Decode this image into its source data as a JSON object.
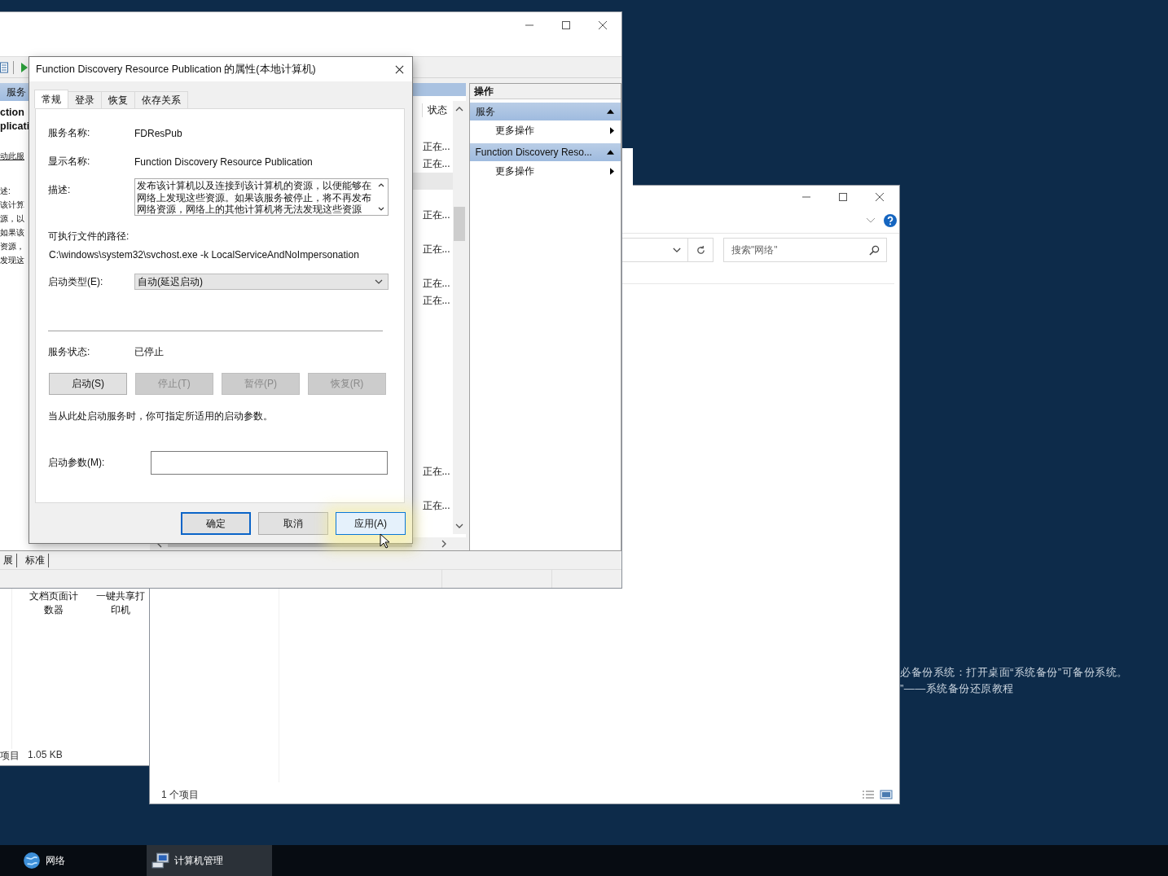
{
  "desktop": {
    "wallpaper_text": [
      "必备份系统：打开桌面“系统备份”可备份系统。",
      "”——系统备份还原教程"
    ]
  },
  "background_explorer": {
    "items": [
      {
        "label": "文档页面计数器"
      },
      {
        "label": "一键共享打印机"
      }
    ],
    "status": [
      "项目",
      "1.05 KB"
    ]
  },
  "network_window": {
    "search": {
      "placeholder": "搜索\"网络\""
    },
    "status_bar": "1 个项目"
  },
  "computer_management": {
    "left_pane": {
      "header": "服务",
      "title_lines": [
        "ction",
        "plicati"
      ],
      "link": "动此服",
      "text_lines": [
        "述:",
        "该计算",
        "源，以",
        "如果该",
        "资源，",
        "发现这"
      ]
    },
    "list": {
      "columns": [
        "状态"
      ],
      "rows": [
        {
          "status": "正在...",
          "selected": false
        },
        {
          "status": "正在...",
          "selected": false
        },
        {
          "selected": true
        },
        {
          "selected": false
        },
        {
          "status": "正在...",
          "selected": false
        },
        {
          "selected": false
        },
        {
          "status": "正在...",
          "selected": false
        },
        {
          "selected": false
        },
        {
          "status": "正在...",
          "selected": false
        },
        {
          "status": "正在...",
          "selected": false
        },
        {
          "selected": false
        },
        {
          "selected": false
        },
        {
          "selected": false
        },
        {
          "selected": false
        },
        {
          "selected": false
        },
        {
          "selected": false
        },
        {
          "selected": false
        },
        {
          "selected": false
        },
        {
          "selected": false
        },
        {
          "status": "正在...",
          "selected": false
        },
        {
          "selected": false
        },
        {
          "status": "正在...",
          "selected": false
        }
      ]
    },
    "actions": {
      "title": "操作",
      "groups": [
        {
          "title": "服务",
          "expanded": true,
          "items": [
            {
              "label": "更多操作"
            }
          ]
        },
        {
          "title": "Function Discovery Reso...",
          "expanded": true,
          "items": [
            {
              "label": "更多操作"
            }
          ]
        }
      ]
    },
    "view_tabs": [
      "展",
      "标准"
    ]
  },
  "dialog": {
    "title": "Function Discovery Resource Publication 的属性(本地计算机)",
    "tabs": [
      {
        "label": "常规",
        "selected": true
      },
      {
        "label": "登录",
        "selected": false
      },
      {
        "label": "恢复",
        "selected": false
      },
      {
        "label": "依存关系",
        "selected": false
      }
    ],
    "service_name": {
      "label": "服务名称:",
      "value": "FDResPub"
    },
    "display_name": {
      "label": "显示名称:",
      "value": "Function Discovery Resource Publication"
    },
    "description": {
      "label": "描述:",
      "value": "发布该计算机以及连接到该计算机的资源，以便能够在网络上发现这些资源。如果该服务被停止，将不再发布网络资源，网络上的其他计算机将无法发现这些资源"
    },
    "path": {
      "label": "可执行文件的路径:",
      "value": "C:\\windows\\system32\\svchost.exe -k LocalServiceAndNoImpersonation"
    },
    "startup_type": {
      "label": "启动类型(E):",
      "value": "自动(延迟启动)"
    },
    "service_status": {
      "label": "服务状态:",
      "value": "已停止"
    },
    "control_buttons": [
      {
        "label": "启动(S)",
        "disabled": false
      },
      {
        "label": "停止(T)",
        "disabled": true
      },
      {
        "label": "暂停(P)",
        "disabled": true
      },
      {
        "label": "恢复(R)",
        "disabled": true
      }
    ],
    "hint": "当从此处启动服务时，你可指定所适用的启动参数。",
    "start_params": {
      "label": "启动参数(M):"
    },
    "footer_buttons": [
      {
        "label": "确定",
        "kind": "default"
      },
      {
        "label": "取消",
        "kind": "normal"
      },
      {
        "label": "应用(A)",
        "kind": "hot"
      }
    ]
  },
  "taskbar": {
    "items": [
      {
        "label": "网络",
        "selected": false
      },
      {
        "label": "计算机管理",
        "selected": true
      }
    ]
  }
}
